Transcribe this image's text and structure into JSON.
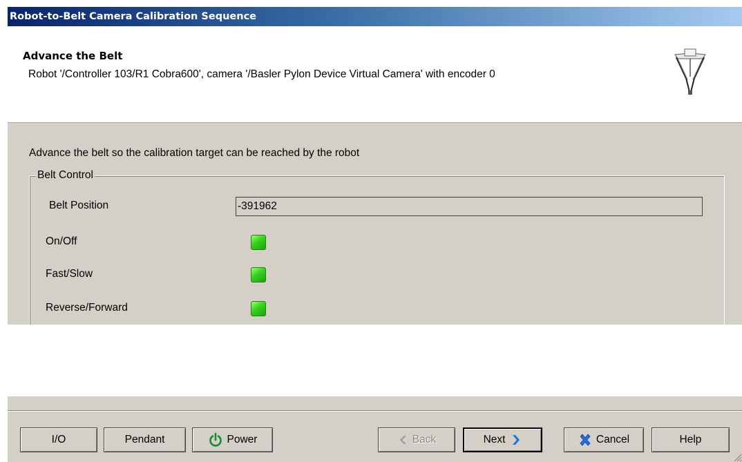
{
  "window": {
    "title": "Robot-to-Belt Camera Calibration Sequence"
  },
  "header": {
    "title": "Advance the Belt",
    "subtitle": "Robot '/Controller 103/R1 Cobra600', camera '/Basler Pylon Device Virtual Camera' with encoder 0",
    "icon": "delta-robot-icon"
  },
  "content": {
    "instruction": "Advance the belt so the calibration target can be reached by the robot",
    "belt_control": {
      "legend": "Belt Control",
      "position_label": "Belt Position",
      "position_value": "-391962",
      "rows": [
        {
          "label": "On/Off",
          "state": "on",
          "color": "#35d11d"
        },
        {
          "label": "Fast/Slow",
          "state": "on",
          "color": "#35d11d"
        },
        {
          "label": "Reverse/Forward",
          "state": "on",
          "color": "#35d11d"
        }
      ]
    }
  },
  "footer": {
    "buttons": {
      "io": "I/O",
      "pendant": "Pendant",
      "power": "Power",
      "back": "Back",
      "next": "Next",
      "cancel": "Cancel",
      "help": "Help"
    },
    "icons": {
      "power": "power-icon",
      "back": "arrow-left-icon",
      "next": "arrow-right-icon",
      "cancel": "x-icon"
    },
    "back_enabled": false
  },
  "colors": {
    "title_gradient_start": "#0a246a",
    "title_gradient_end": "#a6caf0",
    "panel": "#d4d0c8",
    "led_green": "#35d11d",
    "power_icon": "#1a8c2e",
    "arrow_blue": "#1e6fd9",
    "cancel_blue": "#2d6fd6"
  }
}
